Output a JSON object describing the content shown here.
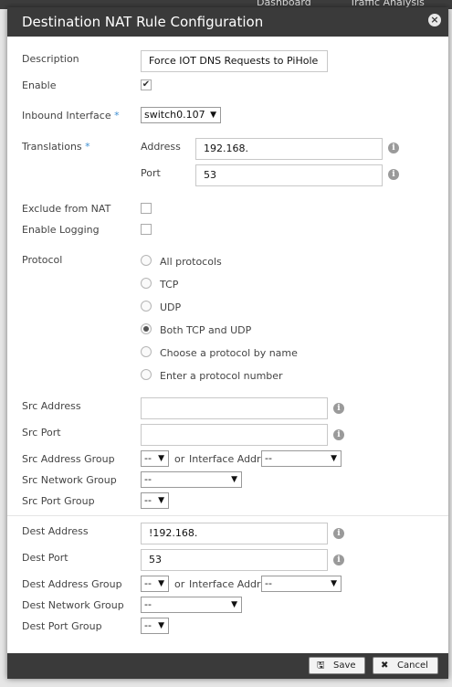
{
  "background": {
    "tabs": [
      "Dashboard",
      "Traffic Analysis"
    ]
  },
  "dialog": {
    "title": "Destination NAT Rule Configuration",
    "close_glyph": "×"
  },
  "form": {
    "description": {
      "label": "Description",
      "value": "Force IOT DNS Requests to PiHole"
    },
    "enable": {
      "label": "Enable",
      "checked": true
    },
    "inbound_interface": {
      "label": "Inbound Interface",
      "required": "*",
      "value": "switch0.107"
    },
    "translations": {
      "label": "Translations",
      "required": "*",
      "address_label": "Address",
      "address_value": "192.168.",
      "port_label": "Port",
      "port_value": "53"
    },
    "exclude_from_nat": {
      "label": "Exclude from NAT",
      "checked": false
    },
    "enable_logging": {
      "label": "Enable Logging",
      "checked": false
    },
    "protocol": {
      "label": "Protocol",
      "options": [
        "All protocols",
        "TCP",
        "UDP",
        "Both TCP and UDP",
        "Choose a protocol by name",
        "Enter a protocol number"
      ],
      "selected": "Both TCP and UDP"
    },
    "src_address": {
      "label": "Src Address",
      "value": ""
    },
    "src_port": {
      "label": "Src Port",
      "value": ""
    },
    "src_address_group": {
      "label": "Src Address Group",
      "value": "--",
      "or": "or",
      "interface_label": "Interface Addr",
      "interface_value": "--"
    },
    "src_network_group": {
      "label": "Src Network Group",
      "value": "--"
    },
    "src_port_group": {
      "label": "Src Port Group",
      "value": "--"
    },
    "dest_address": {
      "label": "Dest Address",
      "value": "!192.168."
    },
    "dest_port": {
      "label": "Dest Port",
      "value": "53"
    },
    "dest_address_group": {
      "label": "Dest Address Group",
      "value": "--",
      "or": "or",
      "interface_label": "Interface Addr",
      "interface_value": "--"
    },
    "dest_network_group": {
      "label": "Dest Network Group",
      "value": "--"
    },
    "dest_port_group": {
      "label": "Dest Port Group",
      "value": "--"
    }
  },
  "footer": {
    "save_label": "Save",
    "cancel_label": "Cancel"
  },
  "icons": {
    "info": "i",
    "dropdown": "▼",
    "check": "✔",
    "save": "🖫",
    "cancel": "✖"
  }
}
